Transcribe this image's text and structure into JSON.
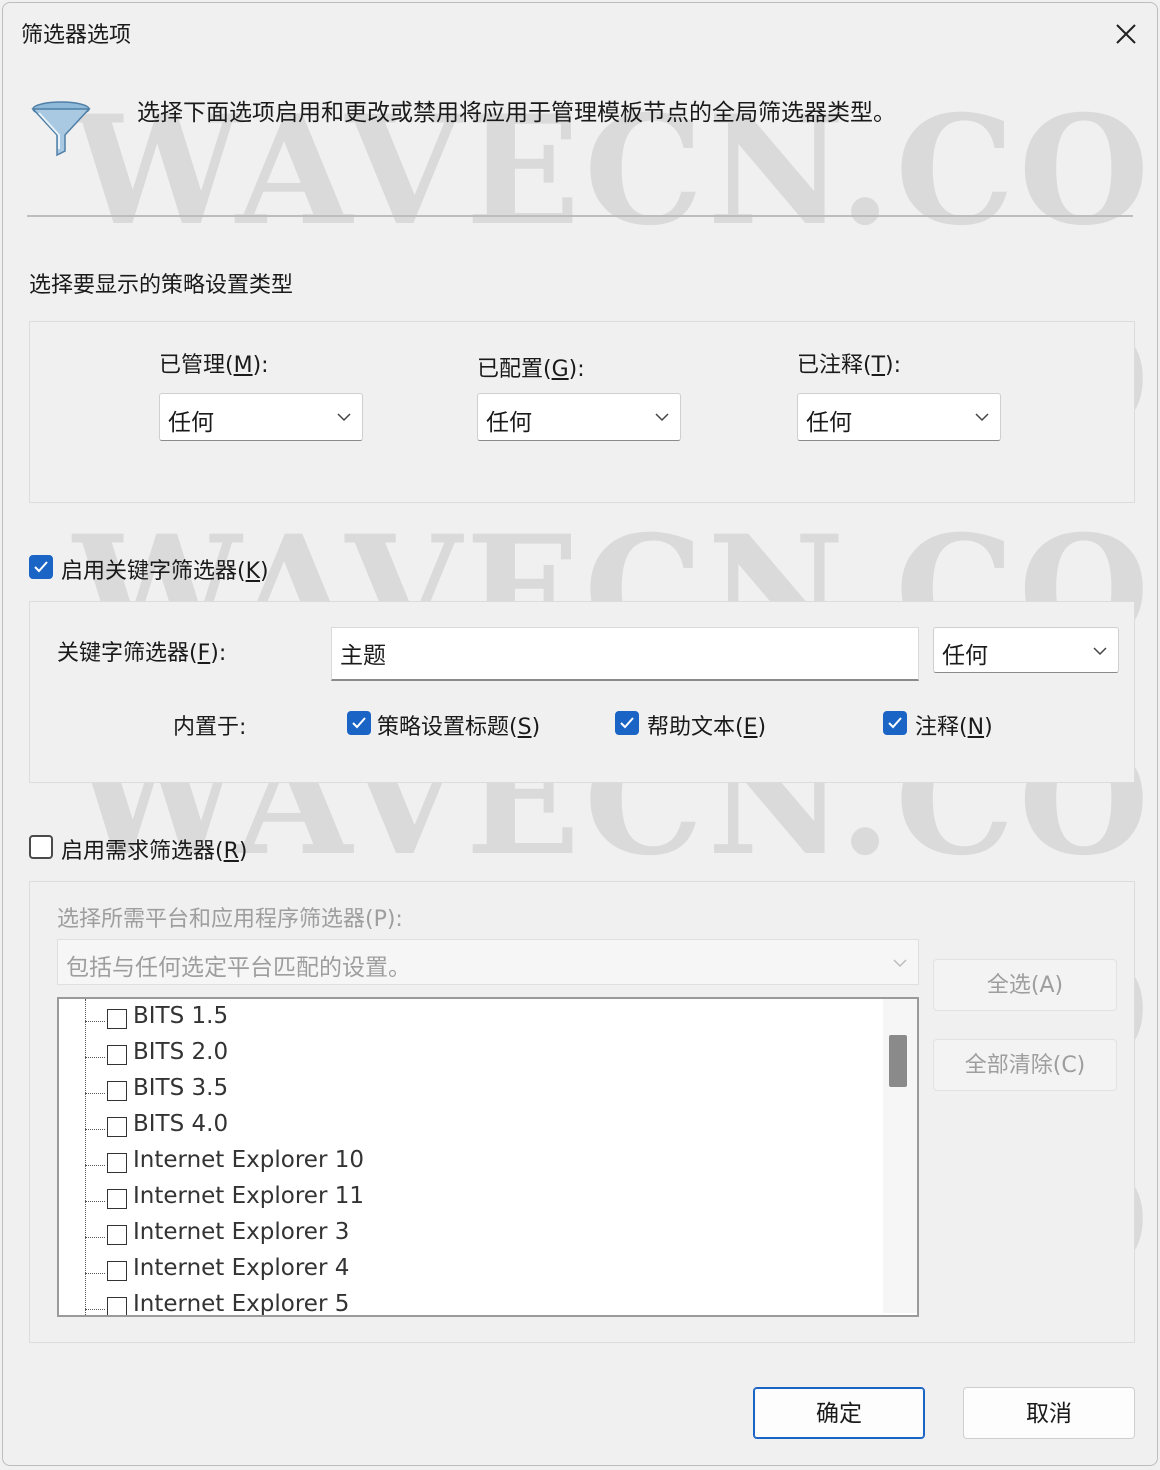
{
  "window": {
    "title": "筛选器选项"
  },
  "header": {
    "description": "选择下面选项启用和更改或禁用将应用于管理模板节点的全局筛选器类型。"
  },
  "policy_types": {
    "label": "选择要显示的策略设置类型",
    "managed": {
      "label_prefix": "已管理(",
      "hotkey": "M",
      "label_suffix": "):",
      "value": "任何"
    },
    "configured": {
      "label_prefix": "已配置(",
      "hotkey": "G",
      "label_suffix": "):",
      "value": "任何"
    },
    "commented": {
      "label_prefix": "已注释(",
      "hotkey": "T",
      "label_suffix": "):",
      "value": "任何"
    }
  },
  "keyword_filter": {
    "enable_prefix": "启用关键字筛选器(",
    "enable_hotkey": "K",
    "enable_suffix": ")",
    "enabled": true,
    "filter_prefix": "关键字筛选器(",
    "filter_hotkey": "F",
    "filter_suffix": "):",
    "filter_text": "主题",
    "match_value": "任何",
    "within_label": "内置于:",
    "opt_title": {
      "prefix": "策略设置标题(",
      "hotkey": "S",
      "suffix": ")",
      "checked": true
    },
    "opt_help": {
      "prefix": "帮助文本(",
      "hotkey": "E",
      "suffix": ")",
      "checked": true
    },
    "opt_comment": {
      "prefix": "注释(",
      "hotkey": "N",
      "suffix": ")",
      "checked": true
    }
  },
  "requirements_filter": {
    "enable_prefix": "启用需求筛选器(",
    "enable_hotkey": "R",
    "enable_suffix": ")",
    "enabled": false,
    "select_label": "选择所需平台和应用程序筛选器(P):",
    "match_value": "包括与任何选定平台匹配的设置。",
    "select_all": "全选(A)",
    "clear_all": "全部清除(C)",
    "items": [
      "BITS 1.5",
      "BITS 2.0",
      "BITS 3.5",
      "BITS 4.0",
      "Internet Explorer 10",
      "Internet Explorer 11",
      "Internet Explorer 3",
      "Internet Explorer 4",
      "Internet Explorer 5"
    ]
  },
  "footer": {
    "ok": "确定",
    "cancel": "取消"
  },
  "watermark": "WAVECN.COM",
  "colors": {
    "accent": "#1a64c6",
    "background": "#f0f0f0"
  },
  "icons": {
    "close": "close-icon",
    "funnel": "funnel-icon",
    "chevron": "chevron-down-icon",
    "check": "checkmark-icon"
  }
}
